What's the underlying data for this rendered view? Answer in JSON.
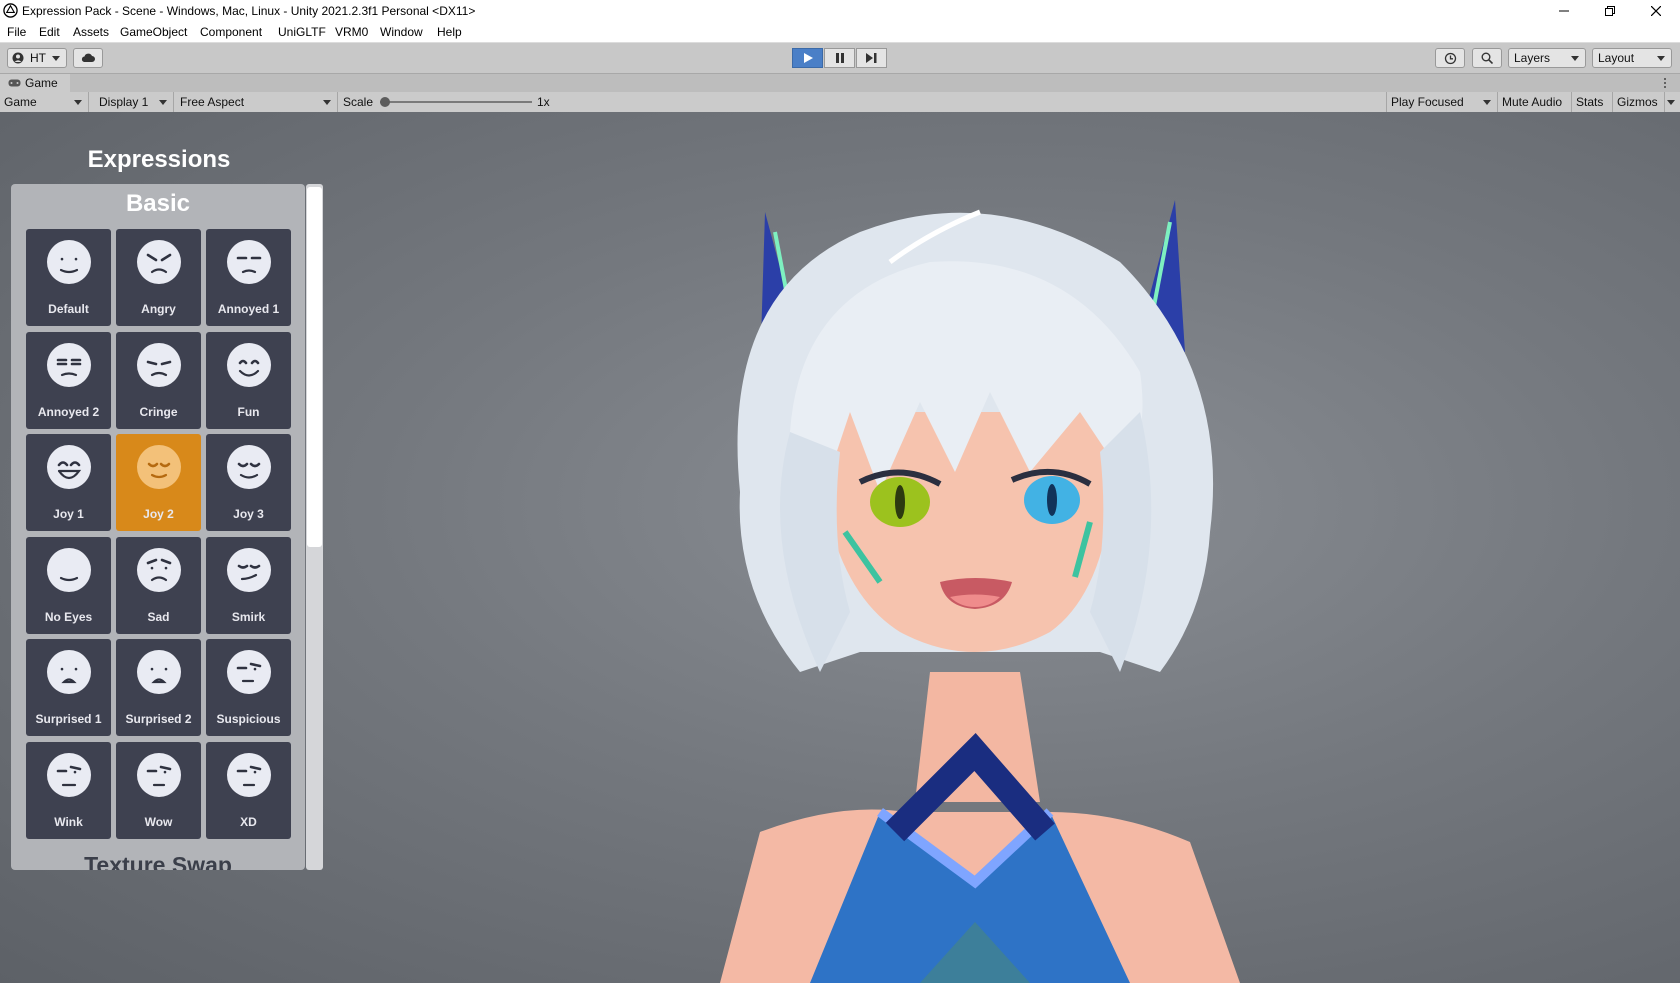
{
  "window": {
    "title": "Expression Pack - Scene - Windows, Mac, Linux - Unity 2021.2.3f1 Personal <DX11>",
    "app_icon": "unity-icon",
    "controls": [
      "minimize-icon",
      "restore-icon",
      "close-icon"
    ]
  },
  "menu": [
    "File",
    "Edit",
    "Assets",
    "GameObject",
    "Component",
    "UniGLTF",
    "VRM0",
    "Window",
    "Help"
  ],
  "toolbar": {
    "account_label": "HT",
    "cloud_icon": "cloud-icon",
    "play_icon": "play-icon",
    "pause_icon": "pause-icon",
    "step_icon": "step-icon",
    "history_icon": "history-icon",
    "search_icon": "search-icon",
    "layers_label": "Layers",
    "layout_label": "Layout"
  },
  "game_tab": {
    "label": "Game",
    "icon": "gamepad-icon"
  },
  "game_bar": {
    "view_select": "Game",
    "display_select": "Display 1",
    "aspect_select": "Free Aspect",
    "scale_label": "Scale",
    "scale_value": "1x",
    "play_focused": "Play Focused",
    "mute_audio": "Mute Audio",
    "stats": "Stats",
    "gizmos": "Gizmos"
  },
  "panel": {
    "title": "Expressions",
    "section_basic": "Basic",
    "section_next": "Texture Swap",
    "selected": "Joy 2",
    "expressions": [
      "Default",
      "Angry",
      "Annoyed 1",
      "Annoyed 2",
      "Cringe",
      "Fun",
      "Joy 1",
      "Joy 2",
      "Joy 3",
      "No Eyes",
      "Sad",
      "Smirk",
      "Surprised 1",
      "Surprised 2",
      "Suspicious",
      "Wink",
      "Wow",
      "XD"
    ]
  },
  "colors": {
    "selected_button": "#d8891a",
    "button": "#3e4150",
    "play_active": "#4a7fc7"
  }
}
